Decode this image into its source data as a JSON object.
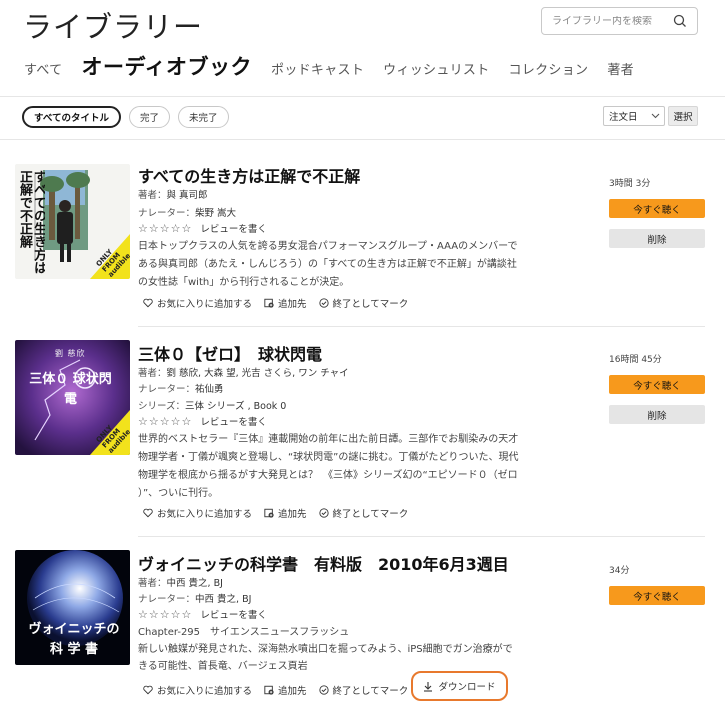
{
  "header": {
    "title": "ライブラリー",
    "search_placeholder": "ライブラリー内を検索"
  },
  "tabs": [
    {
      "label": "すべて",
      "active": false
    },
    {
      "label": "オーディオブック",
      "active": true
    },
    {
      "label": "ポッドキャスト",
      "active": false
    },
    {
      "label": "ウィッシュリスト",
      "active": false
    },
    {
      "label": "コレクション",
      "active": false
    },
    {
      "label": "著者",
      "active": false
    }
  ],
  "filters": {
    "all": "すべてのタイトル",
    "finished": "完了",
    "unfinished": "未完了",
    "sort": "注文日",
    "select": "選択"
  },
  "common": {
    "stars": "☆☆☆☆☆",
    "review": "レビューを書く",
    "favorite": "お気に入りに追加する",
    "add_to": "追加先",
    "mark_finished": "終了としてマーク",
    "listen_now": "今すぐ聴く",
    "delete": "削除",
    "download": "ダウンロード",
    "author_label": "著者：",
    "narrator_label": "ナレーター：",
    "series_label": "シリーズ："
  },
  "items": [
    {
      "title": "すべての生き方は正解で不正解",
      "author": "與 真司郎",
      "narrator": "柴野 嵩大",
      "description_lines": [
        "日本トップクラスの人気を誇る男女混合パフォーマンスグループ・AAAのメンバーで",
        "ある與真司郎（あたえ・しんじろう）の「すべての生き方は正解で不正解」が講談社",
        "の女性誌「with」から刊行されることが決定。"
      ],
      "duration": "3時間 3分",
      "cover_title": "すべての生き方は正解で不正解",
      "cover_badge": "ONLY FROM audible"
    },
    {
      "title": "三体０【ゼロ】　球状閃電",
      "author": "劉 慈欣, 大森 望, 光吉 さくら, ワン チャイ",
      "narrator": "祐仙勇",
      "series": "三体 シリーズ , Book 0",
      "description_lines": [
        "世界的ベストセラー『三体』連載開始の前年に出た前日譚。三部作でお馴染みの天才",
        "物理学者・丁儀が颯爽と登場し、“球状閃電”の謎に挑む。丁儀がたどりついた、現代",
        "物理学を根底から揺るがす大発見とは？　《三体》シリーズ幻の“エピソード０（ゼロ",
        "）”、ついに刊行。"
      ],
      "duration": "16時間 45分",
      "cover_author": "劉 慈欣",
      "cover_title": "三体０ 球状閃電",
      "cover_badge": "ONLY FROM audible"
    },
    {
      "title": "ヴォイニッチの科学書　有料版　2010年6月3週目",
      "author": "中西 貴之, BJ",
      "narrator": "中西 貴之, BJ",
      "description_lines": [
        "Chapter-295　サイエンスニュースフラッシュ",
        "新しい触媒が発見された、深海熱水噴出口を掘ってみよう、iPS細胞でガン治療がで",
        "きる可能性、首長竜、バージェス頁岩"
      ],
      "duration": "34分",
      "cover_title_1": "ヴォイニッチの",
      "cover_title_2": "科 学 書"
    }
  ],
  "colors": {
    "accent": "#f7991c",
    "highlight": "#e8792d",
    "badge_yellow": "#f2e21c"
  }
}
